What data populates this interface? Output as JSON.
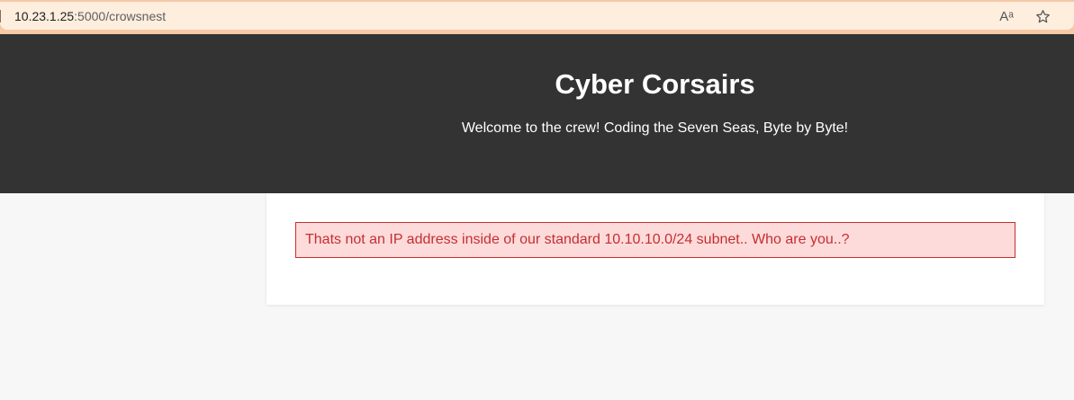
{
  "browser": {
    "url_host": "10.23.1.25",
    "url_rest": ":5000/crowsnest",
    "read_aloud_glyph": "Aᵃ",
    "icons": [
      "read-aloud-icon",
      "favorite-star-icon"
    ]
  },
  "header": {
    "title": "Cyber Corsairs",
    "tagline": "Welcome to the crew! Coding the Seven Seas, Byte by Byte!"
  },
  "main": {
    "error_message": "Thats not an IP address inside of our standard 10.10.10.0/24 subnet.. Who are you..?"
  },
  "colors": {
    "header_bg": "#333333",
    "alert_bg": "#fedbdb",
    "alert_border": "#c62e2e",
    "alert_text": "#c62e2e",
    "browser_bar": "#f6c9a6"
  }
}
